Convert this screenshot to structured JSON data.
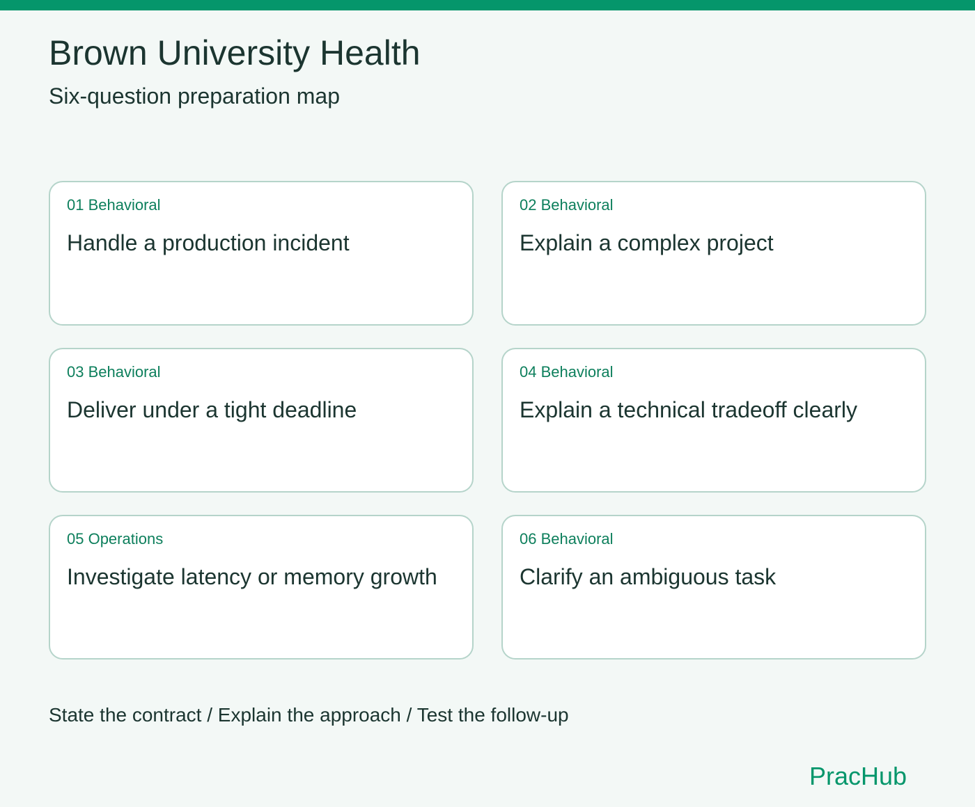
{
  "header": {
    "title": "Brown University Health",
    "subtitle": "Six-question preparation map"
  },
  "cards": [
    {
      "tag": "01 Behavioral",
      "title": "Handle a production incident"
    },
    {
      "tag": "02 Behavioral",
      "title": "Explain a complex project"
    },
    {
      "tag": "03 Behavioral",
      "title": "Deliver under a tight deadline"
    },
    {
      "tag": "04 Behavioral",
      "title": "Explain a technical tradeoff clearly"
    },
    {
      "tag": "05 Operations",
      "title": "Investigate latency or memory growth"
    },
    {
      "tag": "06 Behavioral",
      "title": "Clarify an ambiguous task"
    }
  ],
  "footer": {
    "steps": "State the contract / Explain the approach / Test the follow-up",
    "brand": "PracHub"
  },
  "colors": {
    "accent": "#05966b",
    "text": "#1b3530",
    "tag": "#0d7f5c",
    "card_border": "#b5d4ca",
    "background": "#f3f8f6"
  }
}
